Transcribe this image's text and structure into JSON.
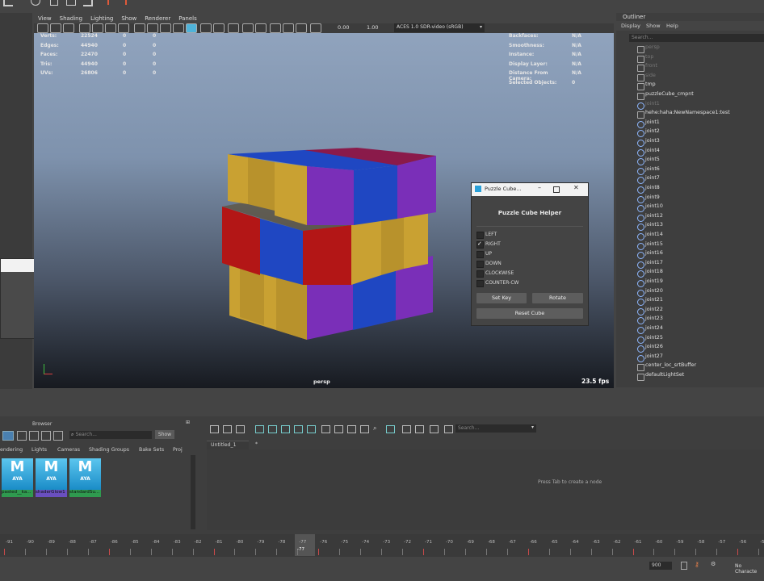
{
  "viewport_menu": [
    "View",
    "Shading",
    "Lighting",
    "Show",
    "Renderer",
    "Panels"
  ],
  "vp_toolbar": {
    "val1": "0.00",
    "val2": "1.00",
    "colorspace": "ACES 1.0 SDR-video (sRGB)"
  },
  "hud_left": [
    {
      "label": "Verts:",
      "a": "22524",
      "b": "0",
      "c": "0"
    },
    {
      "label": "Edges:",
      "a": "44940",
      "b": "0",
      "c": "0"
    },
    {
      "label": "Faces:",
      "a": "22470",
      "b": "0",
      "c": "0"
    },
    {
      "label": "Tris:",
      "a": "44940",
      "b": "0",
      "c": "0"
    },
    {
      "label": "UVs:",
      "a": "26806",
      "b": "0",
      "c": "0"
    }
  ],
  "hud_right": [
    {
      "label": "Backfaces:",
      "value": "N/A"
    },
    {
      "label": "Smoothness:",
      "value": "N/A"
    },
    {
      "label": "Instance:",
      "value": "N/A"
    },
    {
      "label": "Display Layer:",
      "value": "N/A"
    },
    {
      "label": "Distance From Camera:",
      "value": "N/A"
    },
    {
      "label": "Selected Objects:",
      "value": "0"
    }
  ],
  "camera_name": "persp",
  "fps": "23.5 fps",
  "outliner": {
    "title": "Outliner",
    "menu": [
      "Display",
      "Show",
      "Help"
    ],
    "search_placeholder": "Search...",
    "items": [
      "persp",
      "top",
      "front",
      "side",
      "tmp",
      "puzzleCube_cmpnt",
      "joint1",
      "hehe:haha:NewNamespace1:test",
      "joint1",
      "joint2",
      "joint3",
      "joint4",
      "joint5",
      "joint6",
      "joint7",
      "joint8",
      "joint9",
      "joint10",
      "joint12",
      "joint13",
      "joint14",
      "joint15",
      "joint16",
      "joint17",
      "joint18",
      "joint19",
      "joint20",
      "joint21",
      "joint22",
      "joint23",
      "joint24",
      "joint25",
      "joint26",
      "joint27",
      "center_loc_srtBuffer",
      "defaultLightSet"
    ]
  },
  "dialog": {
    "title": "Puzzle Cube...",
    "heading": "Puzzle Cube Helper",
    "options": [
      {
        "label": "LEFT",
        "checked": false
      },
      {
        "label": "RIGHT",
        "checked": true
      },
      {
        "label": "UP",
        "checked": false
      },
      {
        "label": "DOWN",
        "checked": false
      },
      {
        "label": "CLOCKWISE",
        "checked": false
      },
      {
        "label": "COUNTER-CW",
        "checked": false
      }
    ],
    "set_key": "Set Key",
    "rotate": "Rotate",
    "reset": "Reset Cube"
  },
  "hypershade": {
    "browser_label": "Browser",
    "search_placeholder": "Search...",
    "show_label": "Show",
    "tabs": [
      "endering",
      "Lights",
      "Cameras",
      "Shading Groups",
      "Bake Sets",
      "Proj"
    ],
    "materials": [
      {
        "name": "pasted__ka...",
        "color": "#2f9a4f"
      },
      {
        "name": "shaderGlow1",
        "color": "#6a4fbf"
      },
      {
        "name": "standardSu...",
        "color": "#2f9a4f"
      }
    ],
    "tile_text": "AYA",
    "node_search_placeholder": "Search...",
    "tab_untitled": "Untitled_1",
    "tab_add": "*",
    "hint": "Press Tab to create a node"
  },
  "timeline": {
    "ticks": [
      "-91",
      "-90",
      "-89",
      "-88",
      "-87",
      "-86",
      "-85",
      "-84",
      "-83",
      "-82",
      "-81",
      "-80",
      "-79",
      "-78",
      "-77",
      "-76",
      "-75",
      "-74",
      "-73",
      "-72",
      "-71",
      "-70",
      "-69",
      "-68",
      "-67",
      "-66",
      "-65",
      "-64",
      "-63",
      "-62",
      "-61",
      "-60",
      "-59",
      "-58",
      "-57",
      "-56",
      "-55"
    ],
    "current": "-77",
    "end_frame": "900",
    "character": "No Characte"
  }
}
